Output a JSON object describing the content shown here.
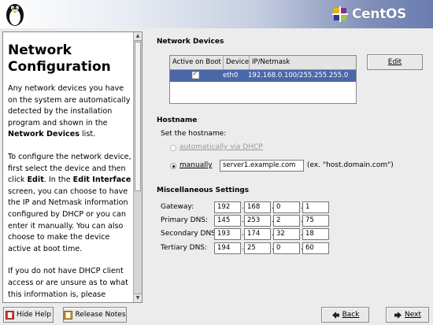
{
  "banner": {
    "logo_text": "CentOS"
  },
  "help": {
    "title": "Network Configuration",
    "paragraphs": [
      [
        {
          "t": "Any network devices you have on the system are automatically detected by the installation program and shown in the "
        },
        {
          "t": "Network Devices",
          "b": true
        },
        {
          "t": " list."
        }
      ],
      [
        {
          "t": "To configure the network device, first select the device and then click "
        },
        {
          "t": "Edit",
          "b": true
        },
        {
          "t": ". In the "
        },
        {
          "t": "Edit Interface",
          "b": true
        },
        {
          "t": " screen, you can choose to have the IP and Netmask information configured by DHCP or you can enter it manually. You can also choose to make the device active at boot time."
        }
      ],
      [
        {
          "t": "If you do not have DHCP client access or are unsure as to what this information is, please"
        }
      ]
    ]
  },
  "devices": {
    "section_label": "Network Devices",
    "columns": [
      "Active on Boot",
      "Device",
      "IP/Netmask"
    ],
    "rows": [
      {
        "active": true,
        "device": "eth0",
        "ip_netmask": "192.168.0.100/255.255.255.0"
      }
    ],
    "edit_button": "Edit"
  },
  "hostname": {
    "section_label": "Hostname",
    "set_label": "Set the hostname:",
    "dhcp_label": "automatically via DHCP",
    "manual_label": "manually",
    "value": "server1.example.com",
    "example": "(ex. \"host.domain.com\")"
  },
  "misc": {
    "section_label": "Miscellaneous Settings",
    "rows": [
      {
        "label": "Gateway:",
        "octets": [
          "192",
          "168",
          "0",
          "1"
        ]
      },
      {
        "label": "Primary DNS:",
        "octets": [
          "145",
          "253",
          "2",
          "75"
        ]
      },
      {
        "label": "Secondary DNS:",
        "octets": [
          "193",
          "174",
          "32",
          "18"
        ]
      },
      {
        "label": "Tertiary DNS:",
        "octets": [
          "194",
          "25",
          "0",
          "60"
        ]
      }
    ]
  },
  "footer": {
    "hide_help": "Hide Help",
    "release_notes": "Release Notes",
    "back": "Back",
    "next": "Next"
  }
}
